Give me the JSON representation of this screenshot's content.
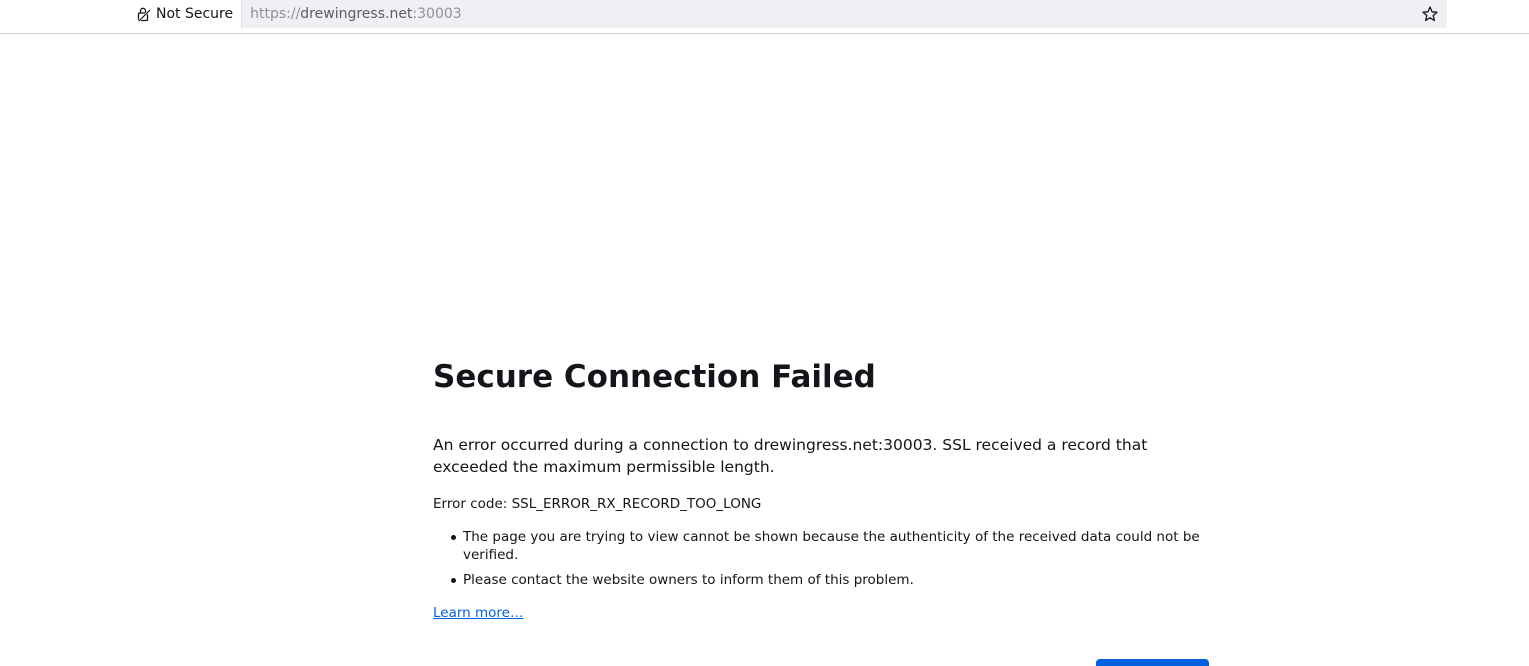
{
  "urlbar": {
    "identity_label": "Not Secure",
    "identity_icon": "lock-warning-icon",
    "url_scheme": "https://",
    "url_host": "drewingress.net",
    "url_port": ":30003",
    "bookmark_icon": "star-icon"
  },
  "error": {
    "title": "Secure Connection Failed",
    "description": "An error occurred during a connection to drewingress.net:30003. SSL received a record that exceeded the maximum permissible length.",
    "error_code": "Error code: SSL_ERROR_RX_RECORD_TOO_LONG",
    "bullets": [
      "The page you are trying to view cannot be shown because the authenticity of the received data could not be verified.",
      "Please contact the website owners to inform them of this problem."
    ],
    "learn_more": "Learn more…",
    "try_again_label": ""
  },
  "colors": {
    "accent": "#0061e0",
    "text": "#15141a",
    "urlbar_bg": "#f0f0f4"
  }
}
